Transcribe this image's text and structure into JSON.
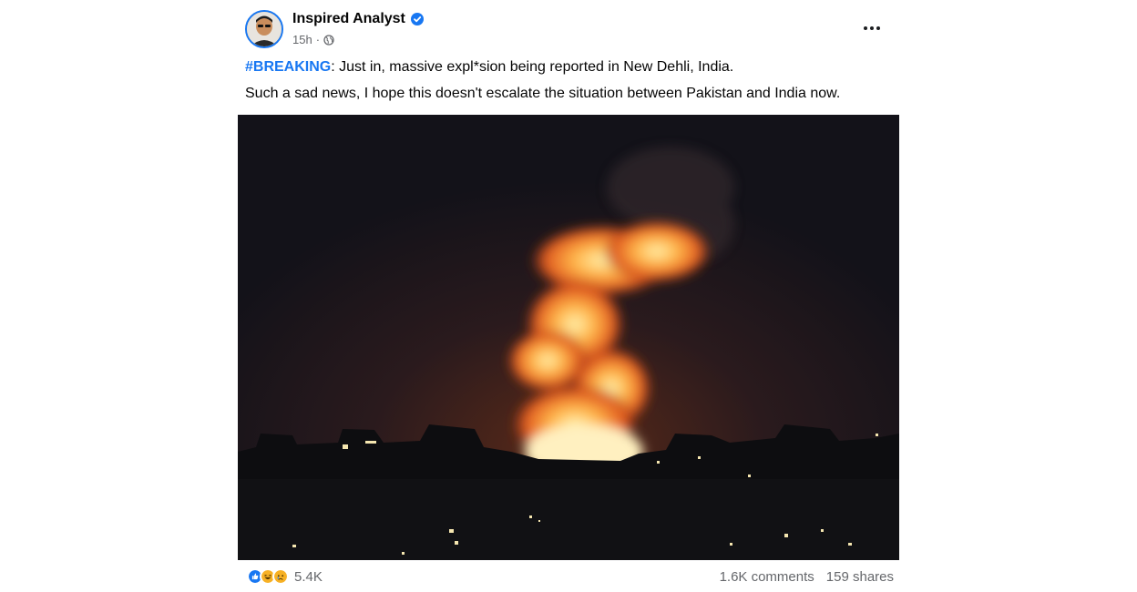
{
  "post": {
    "author": "Inspired Analyst",
    "time": "15h",
    "separator": "·",
    "hashtag": "#BREAKING",
    "line1_rest": ": Just in, massive expl*sion being reported in New Dehli, India.",
    "line2": "Such a sad news, I hope this doesn't escalate the situation between Pakistan and India now.",
    "photo_icon": "night-explosion-photo",
    "verified_icon": "verified-badge-icon",
    "privacy_icon": "globe-icon",
    "reactions": [
      "like-reaction-icon",
      "haha-reaction-icon",
      "sad-reaction-icon"
    ],
    "reaction_count": "5.4K",
    "comments": "1.6K comments",
    "shares": "159 shares"
  },
  "colors": {
    "link": "#1877f2",
    "secondary_text": "#65676b",
    "fire": "#ff8a2b",
    "sky": "#15131b"
  }
}
